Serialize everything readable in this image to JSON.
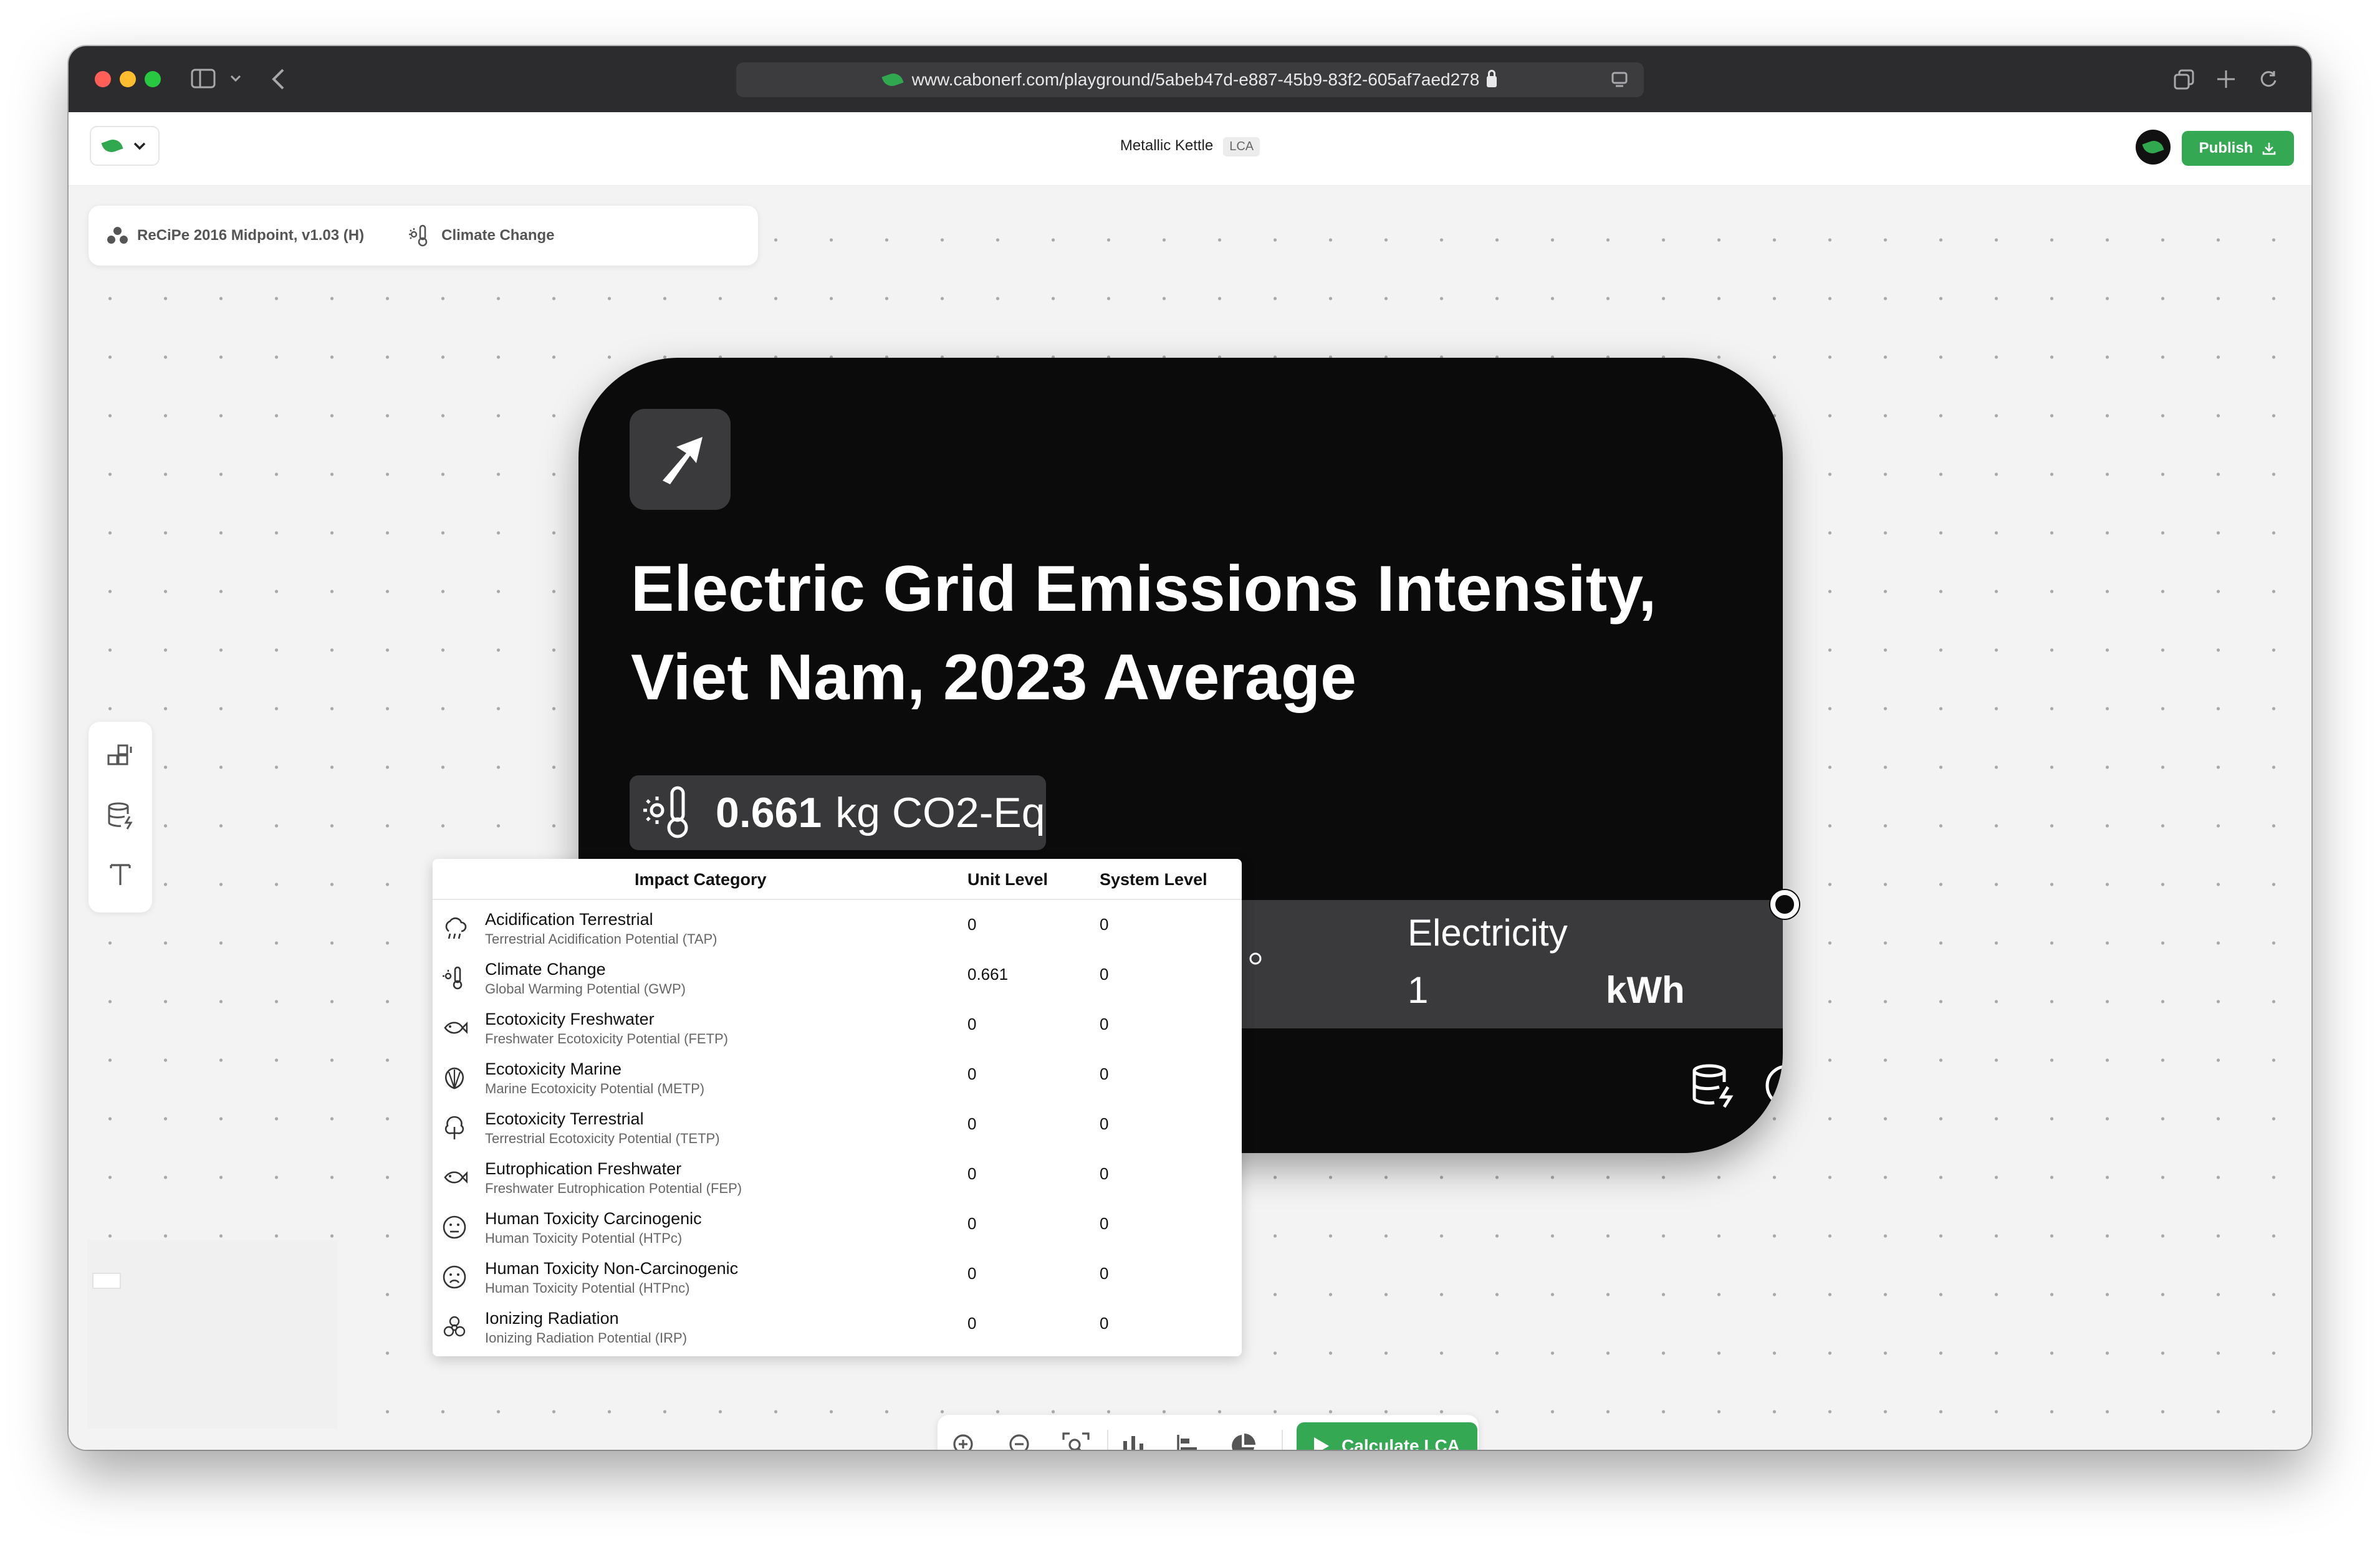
{
  "browser": {
    "url": "www.cabonerf.com/playground/5abeb47d-e887-45b9-83f2-605af7aed278"
  },
  "header": {
    "doc_title": "Metallic Kettle",
    "doc_badge": "LCA",
    "publish_label": "Publish"
  },
  "method": {
    "method_name": "ReCiPe 2016 Midpoint, v1.03 (H)",
    "category_name": "Climate Change"
  },
  "node": {
    "title": "Electric Grid Emissions Intensity, Viet Nam, 2023 Average",
    "impact_value": "0.661",
    "impact_unit": "kg CO2-Eq",
    "flow_name": "Electricity",
    "flow_amount": "1",
    "flow_unit": "kWh"
  },
  "impact_table": {
    "headers": {
      "category": "Impact Category",
      "unit_level": "Unit Level",
      "system_level": "System Level"
    },
    "rows": [
      {
        "name": "Acidification Terrestrial",
        "sub": "Terrestrial Acidification Potential (TAP)",
        "unit": "0",
        "system": "0",
        "icon": "cloud-rain-icon"
      },
      {
        "name": "Climate Change",
        "sub": "Global Warming Potential (GWP)",
        "unit": "0.661",
        "system": "0",
        "icon": "thermometer-sun-icon"
      },
      {
        "name": "Ecotoxicity Freshwater",
        "sub": "Freshwater Ecotoxicity Potential (FETP)",
        "unit": "0",
        "system": "0",
        "icon": "fish-icon"
      },
      {
        "name": "Ecotoxicity Marine",
        "sub": "Marine Ecotoxicity Potential (METP)",
        "unit": "0",
        "system": "0",
        "icon": "shell-icon"
      },
      {
        "name": "Ecotoxicity Terrestrial",
        "sub": "Terrestrial Ecotoxicity Potential (TETP)",
        "unit": "0",
        "system": "0",
        "icon": "tree-icon"
      },
      {
        "name": "Eutrophication Freshwater",
        "sub": "Freshwater Eutrophication Potential (FEP)",
        "unit": "0",
        "system": "0",
        "icon": "fish-icon"
      },
      {
        "name": "Human Toxicity Carcinogenic",
        "sub": "Human Toxicity Potential (HTPc)",
        "unit": "0",
        "system": "0",
        "icon": "face-meh-icon"
      },
      {
        "name": "Human Toxicity Non-Carcinogenic",
        "sub": "Human Toxicity Potential (HTPnc)",
        "unit": "0",
        "system": "0",
        "icon": "face-frown-icon"
      },
      {
        "name": "Ionizing Radiation",
        "sub": "Ionizing Radiation Potential (IRP)",
        "unit": "0",
        "system": "0",
        "icon": "biohazard-icon"
      }
    ]
  },
  "toolbar": {
    "calculate_label": "Calculate LCA"
  },
  "colors": {
    "accent_green": "#34a853",
    "node_bg": "#0b0b0c"
  }
}
